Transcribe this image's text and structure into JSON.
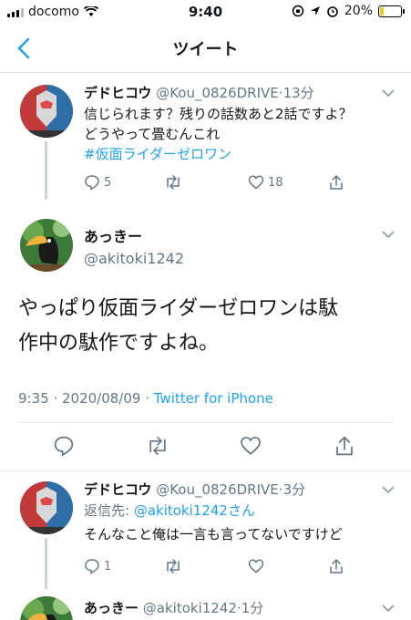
{
  "status_bar": {
    "carrier": "docomo",
    "time": "9:40",
    "battery": "20%",
    "battery_level": 0.2,
    "icons": [
      "signal-icon",
      "wifi-icon",
      "orientation-lock-icon",
      "location-icon",
      "alarm-icon",
      "battery-icon"
    ]
  },
  "nav": {
    "title": "ツイート",
    "back_icon": "chevron-left-icon"
  },
  "tweets": [
    {
      "name": "デドヒコウ",
      "handle": "@Kou_0826DRIVE",
      "time": "13分",
      "lines": [
        "信じられます？残りの話数あと2話ですよ？",
        "どうやって畳むんこれ"
      ],
      "hashtag": "#仮面ライダーゼロワン",
      "replies": "5",
      "likes": "18"
    },
    {
      "name": "デドヒコウ",
      "handle": "@Kou_0826DRIVE",
      "time": "3分",
      "reply_prefix": "返信先: ",
      "reply_to": "@akitoki1242さん",
      "lines": [
        "そんなこと俺は一言も言ってないですけど"
      ],
      "replies": "1"
    },
    {
      "name": "あっきー",
      "handle": "@akitoki1242",
      "time": "1分"
    }
  ],
  "main_tweet": {
    "name": "あっきー",
    "handle": "@akitoki1242",
    "text_lines": [
      "やっぱり仮面ライダーゼロワンは駄",
      "作中の駄作ですよね。"
    ],
    "timestamp": "9:35 · 2020/08/09 · ",
    "source": "Twitter for iPhone"
  },
  "colors": {
    "accent": "#1da1f2",
    "secondary_text": "#657786",
    "divider": "#e1e8ed"
  }
}
